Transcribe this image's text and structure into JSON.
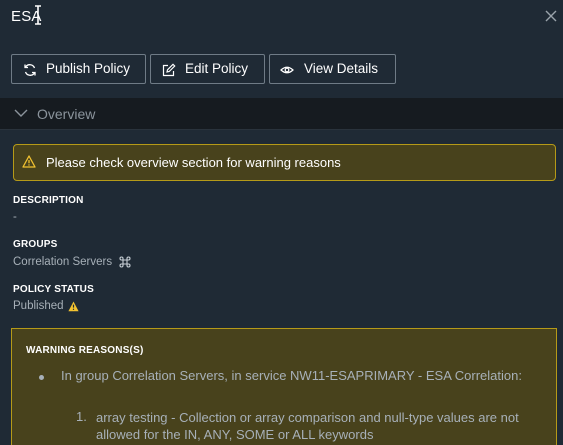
{
  "header": {
    "title": "ESA",
    "buttons": {
      "publish": "Publish Policy",
      "edit": "Edit Policy",
      "view": "View Details"
    }
  },
  "overview": {
    "label": "Overview",
    "warning_banner": "Please check overview section for warning reasons",
    "description": {
      "label": "DESCRIPTION",
      "value": "-"
    },
    "groups": {
      "label": "GROUPS",
      "value": "Correlation Servers"
    },
    "policy_status": {
      "label": "POLICY STATUS",
      "value": "Published"
    },
    "warning_reasons": {
      "title": "WARNING REASONS(S)",
      "group_text": "In group Correlation Servers, in service NW11-ESAPRIMARY - ESA Correlation:",
      "item_number": "1.",
      "item_text": "array testing - Collection or array comparison and null-type values are not allowed for the IN, ANY, SOME or ALL keywords"
    }
  },
  "colors": {
    "background": "#1f2a35",
    "section_bar": "#161b20",
    "warning_fill": "#48421c",
    "warning_border": "#b59a18",
    "warning_icon": "#f2c230"
  },
  "icons": {
    "close": "close-icon",
    "publish": "refresh-icon",
    "edit": "edit-icon",
    "view": "eye-icon",
    "collapse": "chevron-down-icon",
    "warning": "warning-icon",
    "group": "command-icon"
  }
}
